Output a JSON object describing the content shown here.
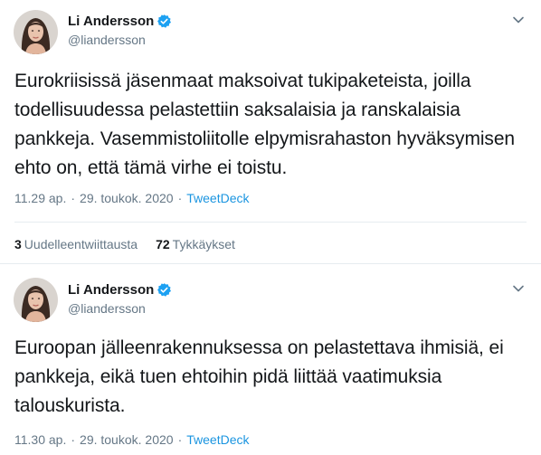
{
  "tweets": [
    {
      "author": {
        "display_name": "Li Andersson",
        "handle": "@liandersson",
        "verified": true
      },
      "text": "Eurokriisissä jäsenmaat maksoivat tukipaketeista, joilla todellisuudessa pelastettiin saksalaisia ja ranskalaisia pankkeja. Vasemmistoliitolle elpymisrahaston hyväksymisen ehto on, että tämä virhe ei toistu.",
      "time": "11.29 ap.",
      "date": "29. toukok. 2020",
      "separator": "·",
      "source": "TweetDeck",
      "retweets_count": "3",
      "retweets_label": "Uudelleentwiittausta",
      "likes_count": "72",
      "likes_label": "Tykkäykset"
    },
    {
      "author": {
        "display_name": "Li Andersson",
        "handle": "@liandersson",
        "verified": true
      },
      "text": "Euroopan jälleenrakennuksessa on pelastettava ihmisiä, ei pankkeja, eikä tuen ehtoihin pidä liittää vaatimuksia talouskurista.",
      "time": "11.30 ap.",
      "date": "29. toukok. 2020",
      "separator": "·",
      "source": "TweetDeck"
    }
  ],
  "colors": {
    "text": "#14171a",
    "secondary": "#657786",
    "link": "#1b95e0",
    "verified": "#1da1f2",
    "divider": "#e6ecf0"
  },
  "icons": [
    "avatar-photo",
    "verified-badge-icon",
    "chevron-down-icon"
  ]
}
